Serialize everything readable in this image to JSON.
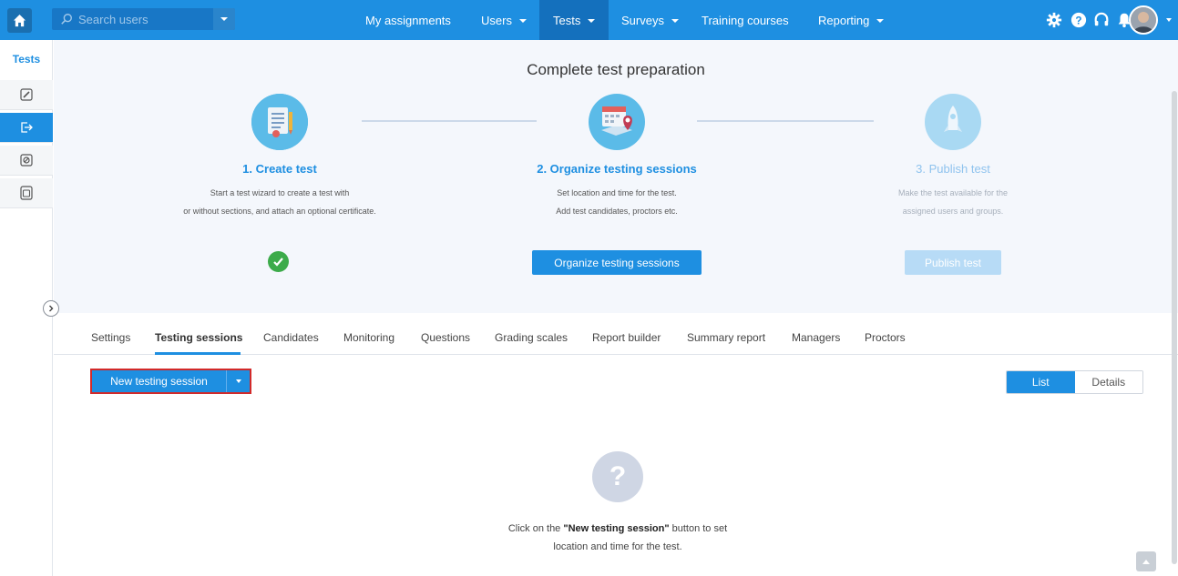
{
  "topbar": {
    "search_placeholder": "Search users",
    "nav": [
      {
        "label": "My assignments"
      },
      {
        "label": "Users"
      },
      {
        "label": "Tests"
      },
      {
        "label": "Surveys"
      },
      {
        "label": "Training courses"
      },
      {
        "label": "Reporting"
      }
    ],
    "accent_color": "#1e8fe1"
  },
  "sidebar": {
    "title": "Tests",
    "items": [
      {
        "icon": "edit-icon"
      },
      {
        "icon": "exit-icon"
      },
      {
        "icon": "block-icon"
      },
      {
        "icon": "archive-icon"
      }
    ]
  },
  "prep": {
    "title": "Complete test preparation",
    "steps": [
      {
        "title": "1. Create test",
        "desc_line1": "Start a test wizard to create a test with",
        "desc_line2": "or without sections, and attach an optional certificate."
      },
      {
        "title": "2. Organize testing sessions",
        "desc_line1": "Set location and time for the test.",
        "desc_line2": "Add test candidates, proctors etc.",
        "button": "Organize testing sessions"
      },
      {
        "title": "3. Publish test",
        "desc_line1": "Make the test available for the",
        "desc_line2": "assigned users and groups.",
        "button": "Publish test"
      }
    ]
  },
  "tabs": [
    {
      "label": "Settings"
    },
    {
      "label": "Testing sessions"
    },
    {
      "label": "Candidates"
    },
    {
      "label": "Monitoring"
    },
    {
      "label": "Questions"
    },
    {
      "label": "Grading scales"
    },
    {
      "label": "Report builder"
    },
    {
      "label": "Summary report"
    },
    {
      "label": "Managers"
    },
    {
      "label": "Proctors"
    }
  ],
  "toolbar": {
    "new_session_label": "New testing session",
    "view_list": "List",
    "view_details": "Details"
  },
  "empty": {
    "icon_glyph": "?",
    "text_before": "Click on the ",
    "text_bold": "\"New testing session\"",
    "text_after": " button to set",
    "text_line2": "location and time for the test."
  }
}
